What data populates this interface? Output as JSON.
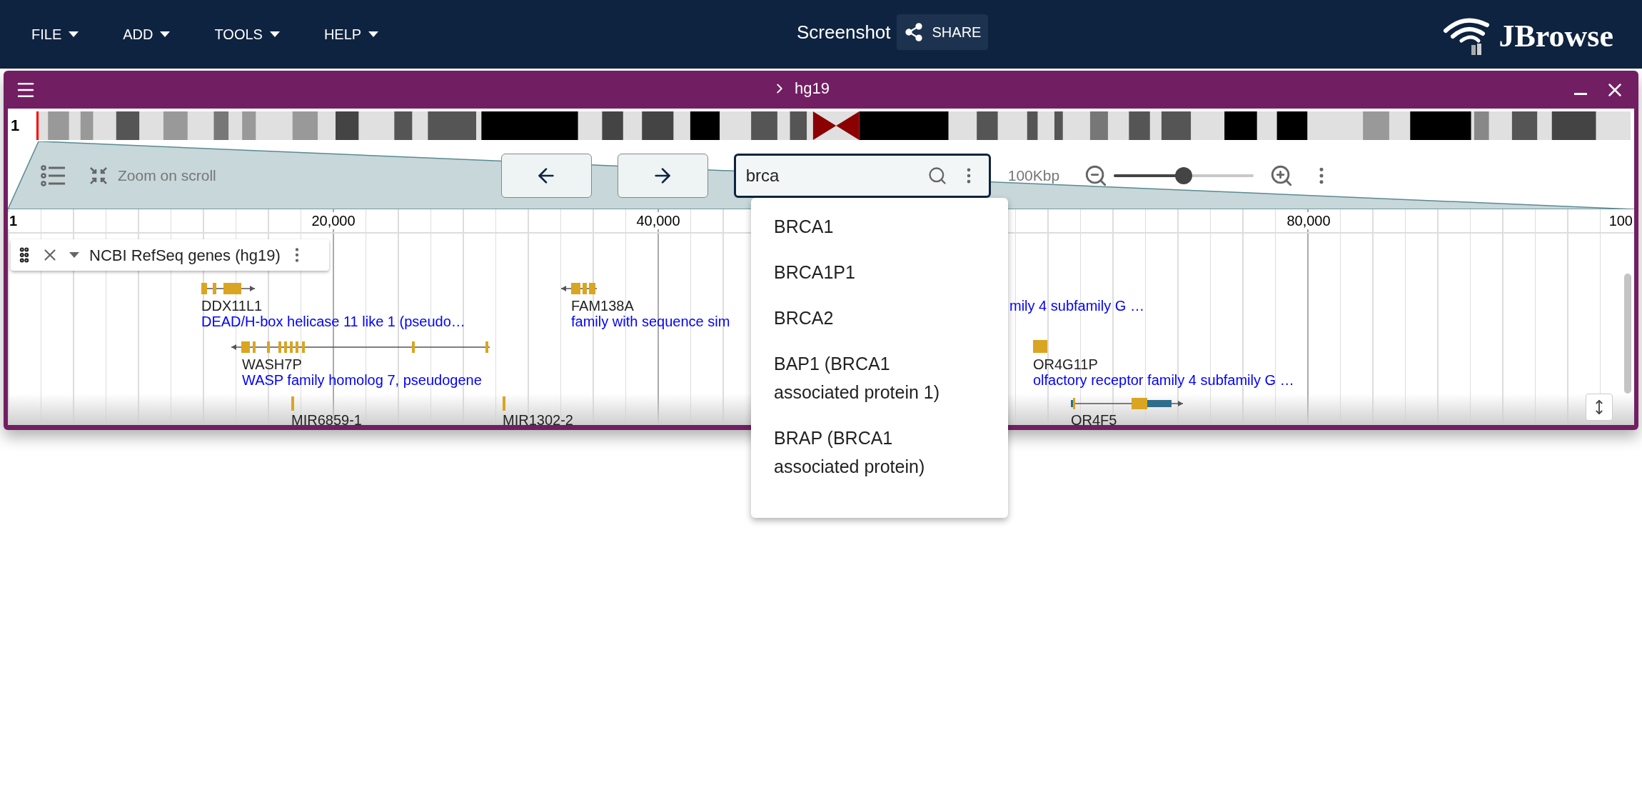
{
  "menu_bar": {
    "items": [
      "FILE",
      "ADD",
      "TOOLS",
      "HELP"
    ],
    "session_title": "Screenshot",
    "share_button": "SHARE",
    "logo": "JBrowse"
  },
  "view": {
    "assembly": "hg19",
    "chromosome": "1",
    "zoom_on_scroll": "Zoom on scroll",
    "search": {
      "value": "brca"
    },
    "scale": "100Kbp",
    "zoom_slider": {
      "level": 0.5
    },
    "ruler": [
      "1",
      "20,000",
      "40,000",
      "80,000",
      "100"
    ],
    "track": {
      "title": "NCBI RefSeq genes (hg19)",
      "features": [
        {
          "name": "DDX11L1",
          "description": "DEAD/H-box helicase 11 like 1 (pseudo…"
        },
        {
          "name": "FAM138A",
          "description": "family with sequence sim"
        },
        {
          "description": "mily 4 subfamily G …"
        },
        {
          "name": "WASH7P",
          "description": "WASP family homolog 7, pseudogene"
        },
        {
          "name": "OR4G11P",
          "description": "olfactory receptor family 4 subfamily G …"
        },
        {
          "name": "MIR6859-1"
        },
        {
          "name": "MIR1302-2"
        },
        {
          "name": "OR4F5"
        }
      ]
    }
  },
  "search_suggestions": [
    {
      "label": "BRCA1"
    },
    {
      "label": "BRCA1P1"
    },
    {
      "label": "BRCA2"
    },
    {
      "label": "BAP1 (BRCA1 associated protein 1)"
    },
    {
      "label": "BRAP (BRCA1 associated protein)"
    }
  ]
}
